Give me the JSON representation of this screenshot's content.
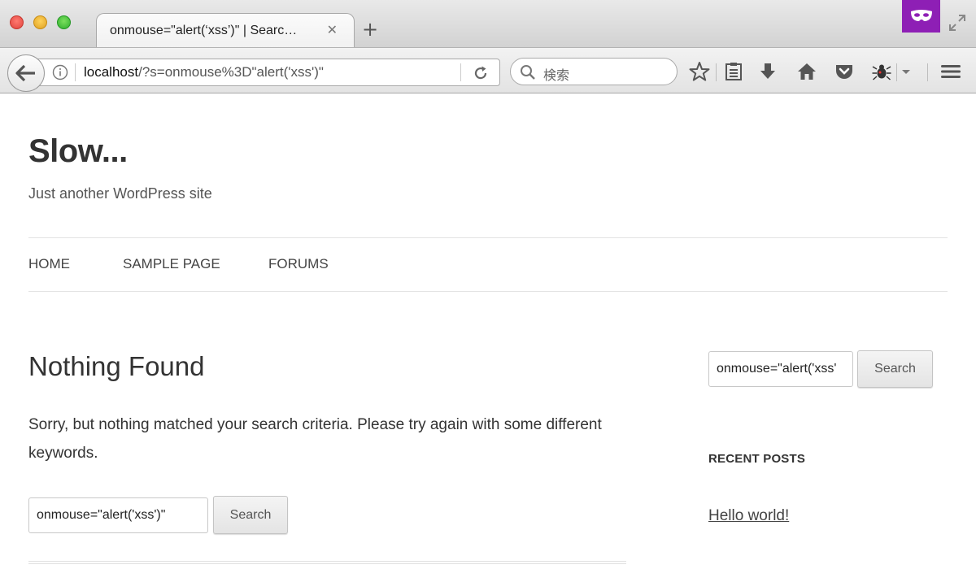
{
  "browser": {
    "tab": {
      "title": "onmouse=\"alert(‘xss’)\" | Searc…",
      "close_glyph": "✕"
    },
    "new_tab_glyph": "+",
    "url": {
      "host": "localhost",
      "path": "/?s=onmouse%3D\"alert('xss')\""
    },
    "search_placeholder": "検索",
    "extension_color": "#8e1fb5",
    "toolbar_icons": [
      "bookmark-star-icon",
      "reading-list-icon",
      "download-icon",
      "home-icon",
      "pocket-icon",
      "bug-extension-icon",
      "dropdown-arrow-icon",
      "hamburger-menu-icon"
    ]
  },
  "site": {
    "title": "Slow...",
    "description": "Just another WordPress site"
  },
  "nav": {
    "items": [
      {
        "label": "HOME"
      },
      {
        "label": "SAMPLE PAGE"
      },
      {
        "label": "FORUMS"
      }
    ]
  },
  "main": {
    "title": "Nothing Found",
    "message": "Sorry, but nothing matched your search criteria. Please try again with some different keywords.",
    "search_value": "onmouse=\"alert('xss')\"",
    "search_button": "Search"
  },
  "sidebar": {
    "search_value": "onmouse=\"alert('xss'",
    "search_button": "Search",
    "recent_posts_title": "RECENT POSTS",
    "recent_posts": [
      {
        "title": "Hello world!"
      }
    ]
  }
}
